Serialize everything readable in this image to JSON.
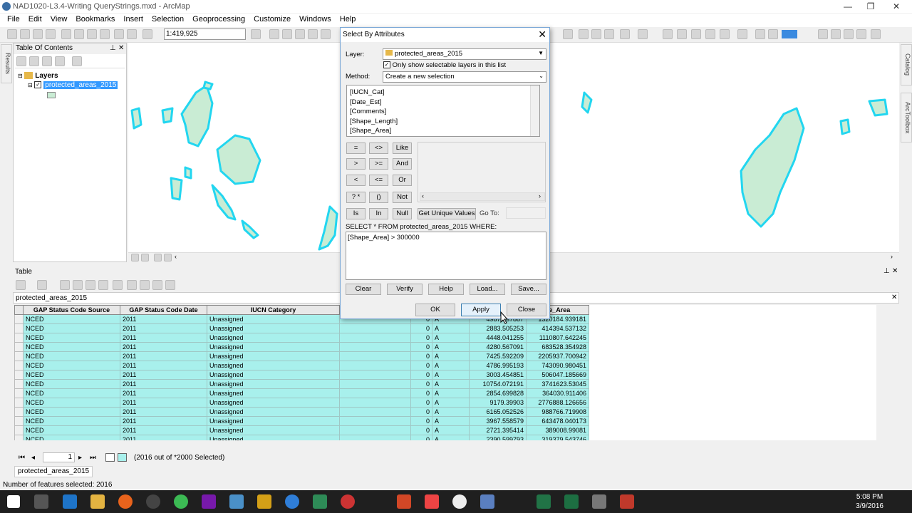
{
  "window": {
    "title": "NAD1020-L3.4-Writing QueryStrings.mxd - ArcMap",
    "min": "—",
    "restore": "❐",
    "close": "✕"
  },
  "menu": [
    "File",
    "Edit",
    "View",
    "Bookmarks",
    "Insert",
    "Selection",
    "Geoprocessing",
    "Customize",
    "Windows",
    "Help"
  ],
  "toolbar": {
    "scale": "1:419,925"
  },
  "toc": {
    "title": "Table Of Contents",
    "pin": "⊥",
    "close": "✕",
    "layers_label": "Layers",
    "layer_name": "protected_areas_2015"
  },
  "side_tabs": {
    "results": "Results",
    "catalog": "Catalog",
    "arctoolbox": "ArcToolbox"
  },
  "table_window": {
    "title": "Table",
    "table_name": "protected_areas_2015",
    "columns": [
      "GAP Status Code Source",
      "GAP Status Code Date",
      "IUCN Category",
      "",
      "",
      "",
      "",
      "pe_Area"
    ],
    "rows": [
      [
        "NCED",
        "2011",
        "Unassigned",
        "",
        "0",
        "A",
        "4987.237887",
        "1320184.939181"
      ],
      [
        "NCED",
        "2011",
        "Unassigned",
        "",
        "0",
        "A",
        "2883.505253",
        "414394.537132"
      ],
      [
        "NCED",
        "2011",
        "Unassigned",
        "",
        "0",
        "A",
        "4448.041255",
        "1110807.642245"
      ],
      [
        "NCED",
        "2011",
        "Unassigned",
        "",
        "0",
        "A",
        "4280.567091",
        "683528.354928"
      ],
      [
        "NCED",
        "2011",
        "Unassigned",
        "",
        "0",
        "A",
        "7425.592209",
        "2205937.700942"
      ],
      [
        "NCED",
        "2011",
        "Unassigned",
        "",
        "0",
        "A",
        "4786.995193",
        "743090.980451"
      ],
      [
        "NCED",
        "2011",
        "Unassigned",
        "",
        "0",
        "A",
        "3003.454851",
        "506047.185669"
      ],
      [
        "NCED",
        "2011",
        "Unassigned",
        "",
        "0",
        "A",
        "10754.072191",
        "3741623.53045"
      ],
      [
        "NCED",
        "2011",
        "Unassigned",
        "",
        "0",
        "A",
        "2854.699828",
        "364030.911406"
      ],
      [
        "NCED",
        "2011",
        "Unassigned",
        "",
        "0",
        "A",
        "9179.39903",
        "2776888.126656"
      ],
      [
        "NCED",
        "2011",
        "Unassigned",
        "",
        "0",
        "A",
        "6165.052526",
        "988766.719908"
      ],
      [
        "NCED",
        "2011",
        "Unassigned",
        "",
        "0",
        "A",
        "3967.558579",
        "643478.040173"
      ],
      [
        "NCED",
        "2011",
        "Unassigned",
        "",
        "0",
        "A",
        "2721.395414",
        "389008.99081"
      ],
      [
        "NCED",
        "2011",
        "Unassigned",
        "",
        "0",
        "A",
        "2390.599793",
        "319379.543746"
      ]
    ],
    "nav": {
      "page": "1",
      "selected_text": "(2016 out of *2000 Selected)"
    },
    "bottom_tab": "protected_areas_2015"
  },
  "status": {
    "text": "Number of features selected: 2016"
  },
  "dialog": {
    "title": "Select By Attributes",
    "close": "✕",
    "layer_label": "Layer:",
    "layer_value": "protected_areas_2015",
    "only_selectable_label": "Only show selectable layers in this list",
    "method_label": "Method:",
    "method_value": "Create a new selection",
    "fields": [
      "[IUCN_Cat]",
      "[Date_Est]",
      "[Comments]",
      "[Shape_Length]",
      "[Shape_Area]"
    ],
    "operators": [
      [
        "=",
        "<>",
        "Like"
      ],
      [
        ">",
        ">=",
        "And"
      ],
      [
        "<",
        "<=",
        "Or"
      ],
      [
        "? *",
        "()",
        "Not"
      ]
    ],
    "is": "Is",
    "in": "In",
    "null": "Null",
    "unique_values": "Get Unique Values",
    "goto_label": "Go To:",
    "where_label": "SELECT * FROM protected_areas_2015 WHERE:",
    "expression": "[Shape_Area] > 300000",
    "buttons": {
      "clear": "Clear",
      "verify": "Verify",
      "help": "Help",
      "load": "Load...",
      "save": "Save...",
      "ok": "OK",
      "apply": "Apply",
      "close": "Close"
    }
  },
  "taskbar": {
    "time": "5:08 PM",
    "date": "3/9/2016"
  },
  "colors": {
    "selection_fill": "#a8f0ec",
    "polygon_fill": "#c9ecd4",
    "polygon_outline": "#22d6f0",
    "taskbar": "#1f1f1f"
  }
}
